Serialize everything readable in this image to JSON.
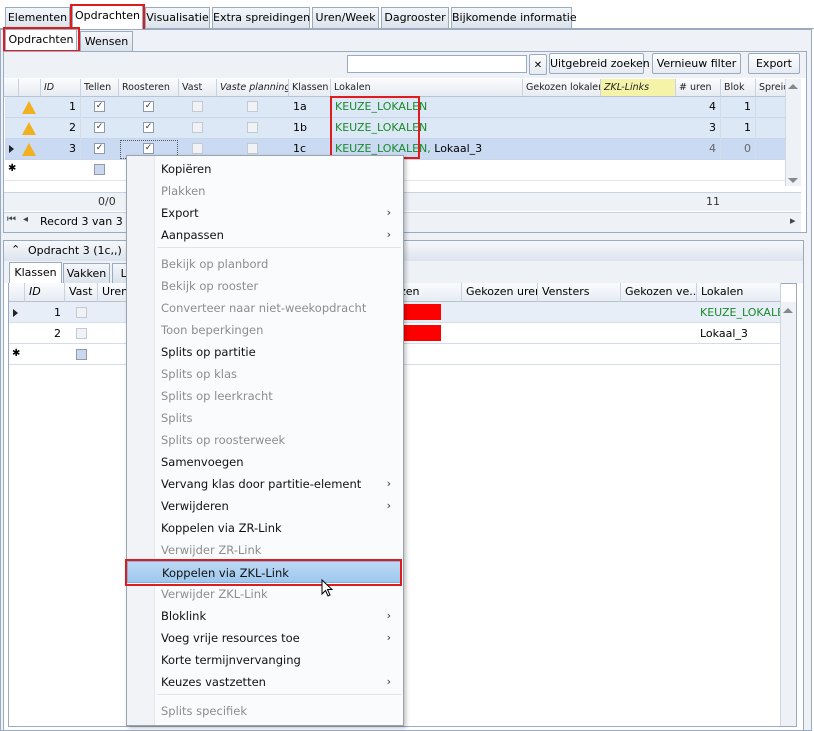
{
  "top_tabs": [
    "Elementen",
    "Opdrachten",
    "Visualisatie",
    "Extra spreidingen",
    "Uren/Week",
    "Dagrooster",
    "Bijkomende informatie"
  ],
  "sub_tabs": [
    "Opdrachten",
    "Wensen"
  ],
  "toolbar": {
    "search_value": "",
    "clear_icon": "✕",
    "advanced_search": "Uitgebreid zoeken",
    "refresh_filter": "Vernieuw filter",
    "export": "Export"
  },
  "top_grid": {
    "headers": [
      "ID",
      "Tellen",
      "Roosteren",
      "Vast",
      "Vaste planning",
      "Klassen",
      "Lokalen",
      "Gekozen lokalen",
      "ZKL-Links",
      "# uren",
      "Blok",
      "Spreiding"
    ],
    "rows": [
      {
        "id": "1",
        "klas": "1a",
        "lokalen_green": "KEUZE_LOKALEN",
        "lokalen_extra": "",
        "uren": "4",
        "blok": "1"
      },
      {
        "id": "2",
        "klas": "1b",
        "lokalen_green": "KEUZE_LOKALEN",
        "lokalen_extra": "",
        "uren": "3",
        "blok": "1"
      },
      {
        "id": "3",
        "klas": "1c",
        "lokalen_green": "KEUZE_LOKALEN,",
        "lokalen_extra": " Lokaal_3",
        "uren": "4",
        "blok": "0"
      }
    ],
    "footer_ratio": "0/0",
    "footer_total": "11"
  },
  "navigator": {
    "record": "Record 3 van 3"
  },
  "bottom_panel": {
    "title": "Opdracht 3 (1c,,)",
    "tabs": [
      "Klassen",
      "Vakken",
      "Le"
    ],
    "headers": [
      "ID",
      "Vast",
      "Uren",
      "zen",
      "Gekozen uren",
      "Vensters",
      "Gekozen ve...",
      "Lokalen"
    ],
    "rows": [
      {
        "id": "1",
        "lokalen": "KEUZE_LOKALEN"
      },
      {
        "id": "2",
        "lokalen": "Lokaal_3"
      }
    ]
  },
  "context_menu": {
    "items": [
      {
        "label": "Kopiëren",
        "disabled": false,
        "submenu": false
      },
      {
        "label": "Plakken",
        "disabled": true,
        "submenu": false
      },
      {
        "label": "Export",
        "disabled": false,
        "submenu": true
      },
      {
        "label": "Aanpassen",
        "disabled": false,
        "submenu": true
      },
      {
        "label": "Bekijk op planbord",
        "disabled": true,
        "submenu": false
      },
      {
        "label": "Bekijk op rooster",
        "disabled": true,
        "submenu": false
      },
      {
        "label": "Converteer naar niet-weekopdracht",
        "disabled": true,
        "submenu": false
      },
      {
        "label": "Toon beperkingen",
        "disabled": true,
        "submenu": false
      },
      {
        "label": "Splits op partitie",
        "disabled": false,
        "submenu": false
      },
      {
        "label": "Splits op klas",
        "disabled": true,
        "submenu": false
      },
      {
        "label": "Splits op leerkracht",
        "disabled": true,
        "submenu": false
      },
      {
        "label": "Splits",
        "disabled": true,
        "submenu": false
      },
      {
        "label": "Splits op roosterweek",
        "disabled": true,
        "submenu": false
      },
      {
        "label": "Samenvoegen",
        "disabled": false,
        "submenu": false
      },
      {
        "label": "Vervang klas door partitie-element",
        "disabled": false,
        "submenu": true
      },
      {
        "label": "Verwijderen",
        "disabled": false,
        "submenu": true
      },
      {
        "label": "Koppelen via ZR-Link",
        "disabled": false,
        "submenu": false
      },
      {
        "label": "Verwijder ZR-Link",
        "disabled": true,
        "submenu": false
      },
      {
        "label": "Koppelen via ZKL-Link",
        "disabled": false,
        "submenu": false,
        "highlighted": true
      },
      {
        "label": "Verwijder ZKL-Link",
        "disabled": true,
        "submenu": false
      },
      {
        "label": "Bloklink",
        "disabled": false,
        "submenu": true
      },
      {
        "label": "Voeg vrije resources toe",
        "disabled": false,
        "submenu": true
      },
      {
        "label": "Korte termijnvervanging",
        "disabled": false,
        "submenu": false
      },
      {
        "label": "Keuzes vastzetten",
        "disabled": false,
        "submenu": true
      },
      {
        "label": "Splits specifiek",
        "disabled": true,
        "submenu": false
      }
    ]
  },
  "colors": {
    "highlight_red": "#e01b1b",
    "keuze_green": "#1a8a2a",
    "selected_row": "#dde8f7"
  }
}
